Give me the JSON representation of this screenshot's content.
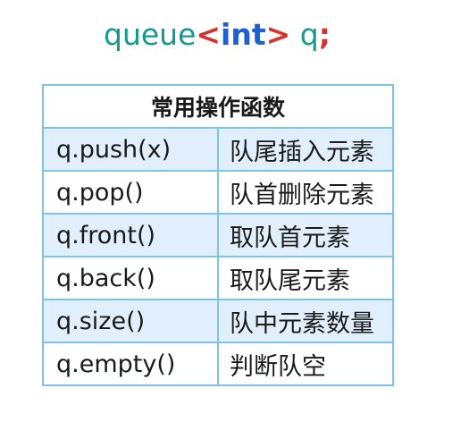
{
  "code": {
    "kw_queue": "queue",
    "open_angle": "<",
    "type": "int",
    "close_angle": ">",
    "var": " q",
    "semicolon": ";"
  },
  "table": {
    "header": "常用操作函数",
    "rows": [
      {
        "func": "q.push(x)",
        "desc": "队尾插入元素"
      },
      {
        "func": "q.pop()",
        "desc": "队首删除元素"
      },
      {
        "func": "q.front()",
        "desc": "取队首元素"
      },
      {
        "func": "q.back()",
        "desc": "取队尾元素"
      },
      {
        "func": "q.size()",
        "desc": "队中元素数量"
      },
      {
        "func": "q.empty()",
        "desc": "判断队空"
      }
    ]
  },
  "colors": {
    "code_teal": "#149a8c",
    "code_red": "#d8302c",
    "code_blue": "#1f5fd1",
    "table_border": "#7ec3ea",
    "row_shade": "#e0effb"
  }
}
